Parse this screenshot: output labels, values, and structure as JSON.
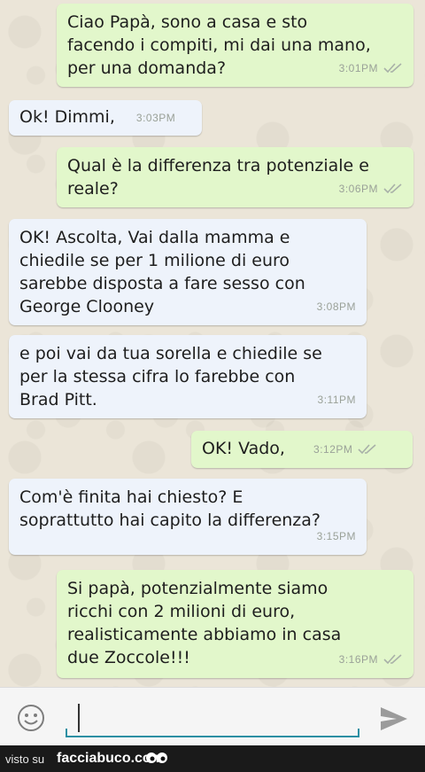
{
  "messages": [
    {
      "dir": "out",
      "text": "Ciao Papà, sono a casa e sto\nfacendo i compiti, mi dai una mano,\nper una domanda?",
      "time": "3:01PM",
      "ticks": true
    },
    {
      "dir": "in",
      "text": "Ok! Dimmi,",
      "time": "3:03PM"
    },
    {
      "dir": "out",
      "text": "Qual è la differenza tra potenziale e\nreale?",
      "time": "3:06PM",
      "ticks": true
    },
    {
      "dir": "in",
      "text": "OK! Ascolta, Vai dalla mamma e\nchiedile se per 1 milione di euro\nsarebbe disposta a fare sesso con\nGeorge Clooney",
      "time": "3:08PM"
    },
    {
      "dir": "in",
      "text": "e poi vai da tua sorella e chiedile se\nper la stessa cifra lo farebbe con\nBrad Pitt.",
      "time": "3:11PM"
    },
    {
      "dir": "out",
      "text": "OK! Vado,",
      "time": "3:12PM",
      "ticks": true
    },
    {
      "dir": "in",
      "text": "Com'è finita hai chiesto? E\nsoprattutto hai capito la differenza?",
      "time": "3:15PM"
    },
    {
      "dir": "out",
      "text": "Si papà, potenzialmente siamo\nricchi con 2 milioni di euro,\nrealisticamente abbiamo in casa\ndue Zoccole!!!",
      "time": "3:16PM",
      "ticks": true
    }
  ],
  "composer": {
    "placeholder": ""
  },
  "footer": {
    "prefix": "visto su",
    "brand": "facciabuco.com"
  },
  "colors": {
    "outgoing": "#e2f7cb",
    "incoming": "#eef3fb",
    "accent": "#2c8fa3"
  },
  "icons": {
    "emoji": "emoji-icon",
    "send": "send-icon",
    "ticks": "double-check-icon"
  }
}
